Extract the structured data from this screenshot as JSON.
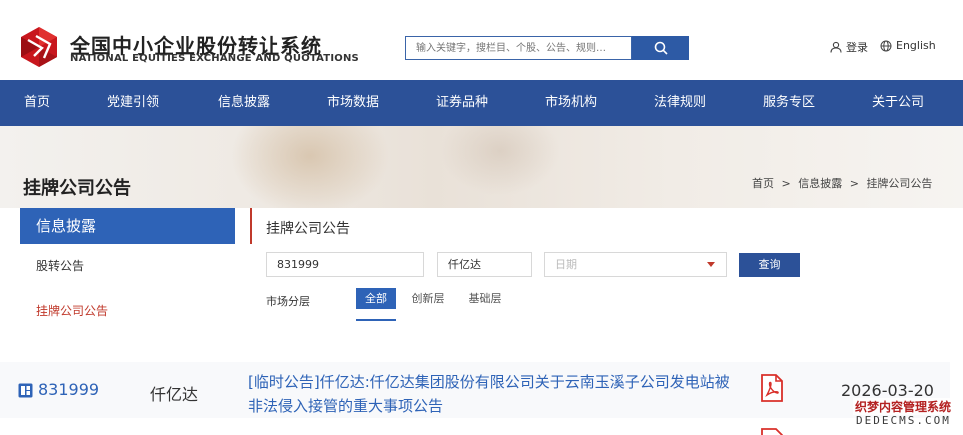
{
  "header": {
    "logo_cn": "全国中小企业股份转让系统",
    "logo_en": "NATIONAL EQUITIES EXCHANGE AND QUOTATIONS",
    "search_placeholder": "输入关键字，搜栏目、个股、公告、规则…",
    "login_label": "登录",
    "lang_label": "English",
    "brand_color": "#c8161d"
  },
  "nav": {
    "items": [
      "首页",
      "党建引领",
      "信息披露",
      "市场数据",
      "证券品种",
      "市场机构",
      "法律规则",
      "服务专区",
      "关于公司"
    ],
    "bg_color": "#2c5198"
  },
  "page": {
    "title": "挂牌公司公告",
    "breadcrumb": [
      "首页",
      "信息披露",
      "挂牌公司公告"
    ],
    "breadcrumb_sep": ">"
  },
  "sidebar": {
    "head": "信息披露",
    "items": [
      "股转公告",
      "挂牌公司公告"
    ]
  },
  "panel": {
    "title": "挂牌公司公告",
    "code_value": "831999",
    "name_value": "仟亿达",
    "date_placeholder": "日期",
    "query_label": "查询",
    "tier_label": "市场分层",
    "tiers": [
      "全部",
      "创新层",
      "基础层"
    ]
  },
  "results": [
    {
      "code": "831999",
      "company": "仟亿达",
      "title": "[临时公告]仟亿达:仟亿达集团股份有限公司关于云南玉溪子公司发电站被非法侵入接管的重大事项公告",
      "date": "2026-03-20"
    }
  ],
  "watermark": {
    "cn": "织梦内容管理系统",
    "en": "DEDECMS.COM"
  }
}
